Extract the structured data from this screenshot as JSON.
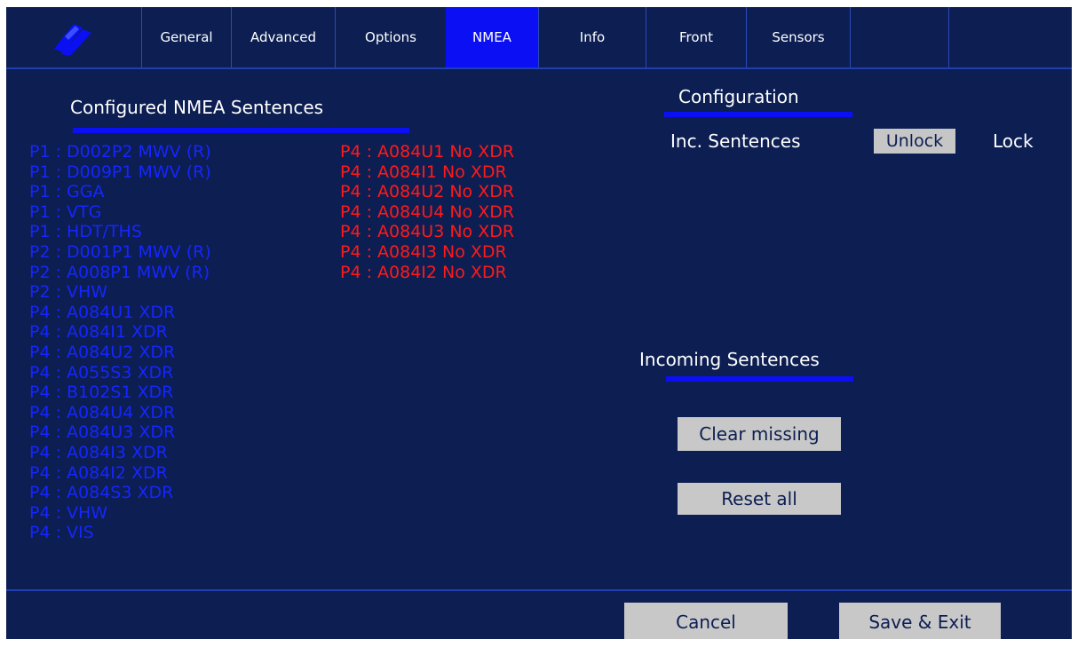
{
  "tabs": [
    {
      "label": "General"
    },
    {
      "label": "Advanced"
    },
    {
      "label": "Options"
    },
    {
      "label": "NMEA",
      "active": true
    },
    {
      "label": "Info"
    },
    {
      "label": "Front"
    },
    {
      "label": "Sensors"
    },
    {
      "label": ""
    },
    {
      "label": ""
    }
  ],
  "configured": {
    "title": "Configured NMEA Sentences",
    "blue_list": [
      "P1 : D002P2 MWV (R)",
      "P1 : D009P1 MWV (R)",
      "P1 : GGA",
      "P1 : VTG",
      "P1 : HDT/THS",
      "P2 : D001P1 MWV (R)",
      "P2 : A008P1 MWV (R)",
      "P2 : VHW",
      "P4 : A084U1 XDR",
      "P4 : A084I1 XDR",
      "P4 : A084U2 XDR",
      "P4 : A055S3 XDR",
      "P4 : B102S1 XDR",
      "P4 : A084U4 XDR",
      "P4 : A084U3 XDR",
      "P4 : A084I3 XDR",
      "P4 : A084I2 XDR",
      "P4 : A084S3 XDR",
      "P4 : VHW",
      "P4 : VIS"
    ],
    "red_list": [
      "P4 : A084U1 No XDR",
      "P4 : A084I1 No XDR",
      "P4 : A084U2 No XDR",
      "P4 : A084U4 No XDR",
      "P4 : A084U3 No XDR",
      "P4 : A084I3 No XDR",
      "P4 : A084I2 No XDR"
    ]
  },
  "configuration": {
    "title": "Configuration",
    "inc_label": "Inc. Sentences",
    "unlock_label": "Unlock",
    "lock_label": "Lock"
  },
  "incoming": {
    "title": "Incoming Sentences",
    "clear_label": "Clear missing",
    "reset_label": "Reset all"
  },
  "footer": {
    "cancel_label": "Cancel",
    "save_label": "Save & Exit"
  },
  "colors": {
    "background": "#0c1e52",
    "accent": "#0b10f4",
    "configured_ok": "#1526ff",
    "configured_missing": "#ff1a1a",
    "button": "#c8c8c8"
  },
  "icons": {
    "logo": "brand-logo-icon"
  }
}
